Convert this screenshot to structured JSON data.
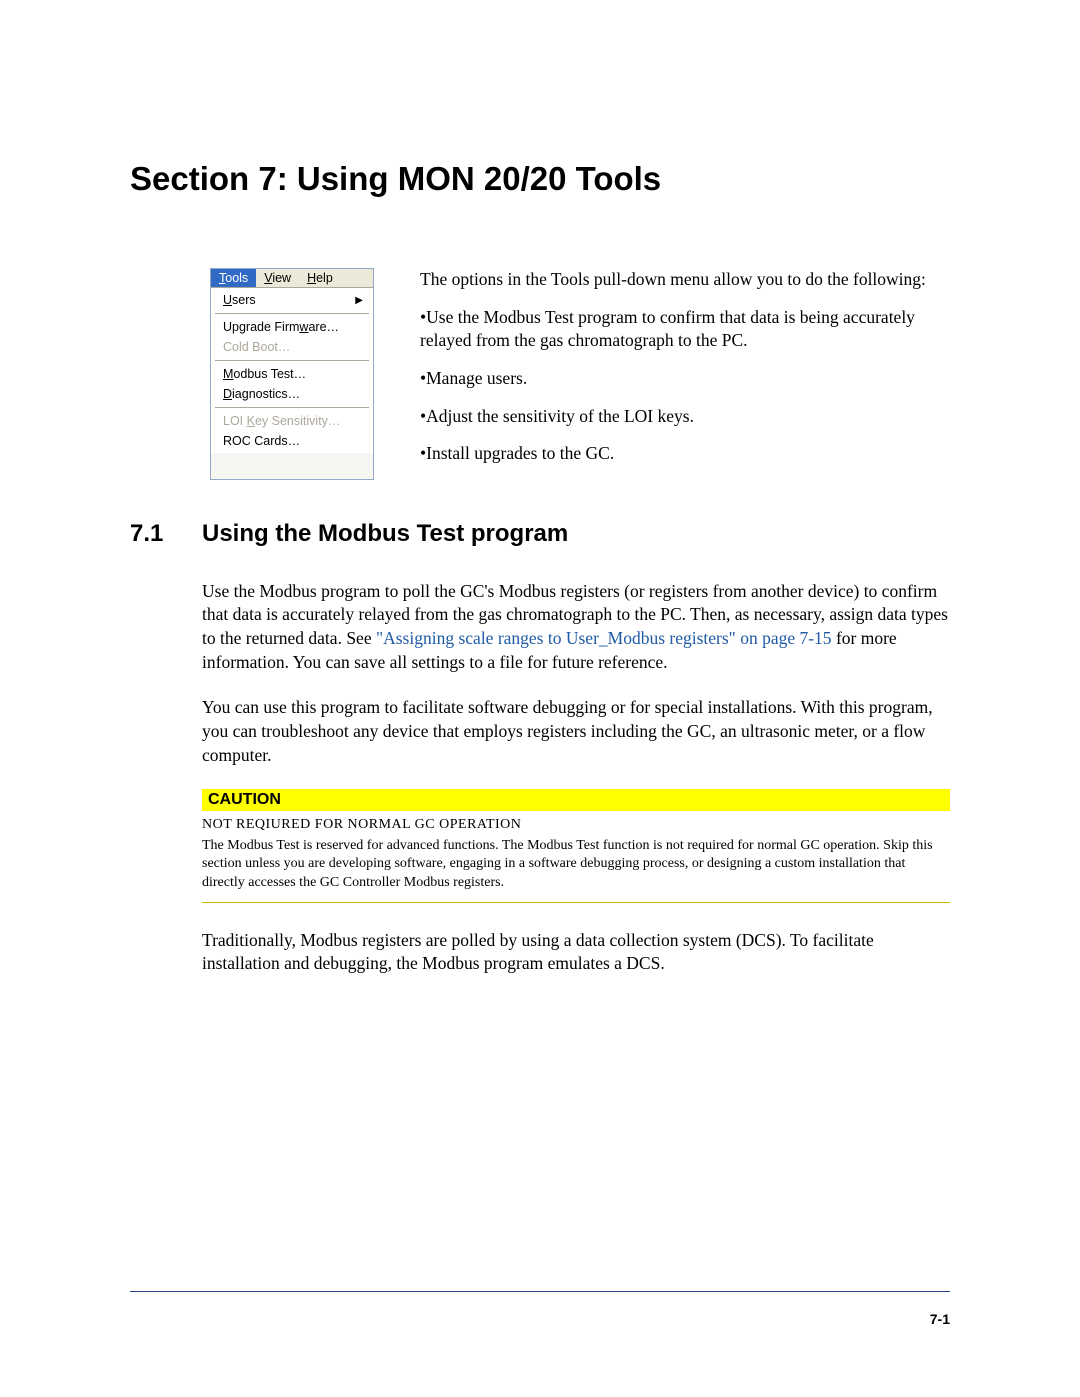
{
  "section_title": "Section 7: Using MON 20/20 Tools",
  "menu": {
    "bar": {
      "tools": "Tools",
      "view": "View",
      "help": "Help"
    },
    "items": {
      "users": "Users",
      "upgrade": "Upgrade Firmware…",
      "cold_boot": "Cold Boot…",
      "modbus": "Modbus Test…",
      "diagnostics": "Diagnostics…",
      "loi": "LOI Key Sensitivity…",
      "roc": "ROC Cards…"
    }
  },
  "top": {
    "intro": "The options in the Tools pull-down menu allow you to do the following:",
    "b1": "•Use the Modbus Test program to confirm that data is being accurately relayed from the gas chromatograph to the PC.",
    "b2": "•Manage users.",
    "b3": "•Adjust the sensitivity of the LOI keys.",
    "b4": "•Install upgrades to the GC."
  },
  "sub": {
    "num": "7.1",
    "title": "Using the Modbus Test program"
  },
  "para1_a": "Use the Modbus program to poll the GC's Modbus registers (or registers from another device) to confirm that data is accurately relayed from the gas chromatograph to the PC. Then, as necessary, assign data types to the returned data.  See ",
  "para1_link": "\"Assigning scale ranges to User_Modbus registers\" on page 7-15",
  "para1_b": " for more information. You can save all settings to a file for future reference.",
  "para2": "You can use this program to facilitate software debugging or for special installations. With this program, you can troubleshoot any device that employs registers including the GC, an ultrasonic meter, or a flow computer.",
  "caution": {
    "header": "CAUTION",
    "sub": "NOT REQIURED FOR NORMAL GC OPERATION",
    "body": "The Modbus Test is reserved for advanced functions. The Modbus Test function is not required for normal GC operation. Skip this section unless you are developing software, engaging in a software debugging process, or designing a custom installation that directly accesses the GC Controller Modbus registers."
  },
  "para3": "Traditionally, Modbus registers are polled by using a data collection system (DCS). To facilitate installation and debugging, the Modbus program emulates a DCS.",
  "page_num": "7-1"
}
